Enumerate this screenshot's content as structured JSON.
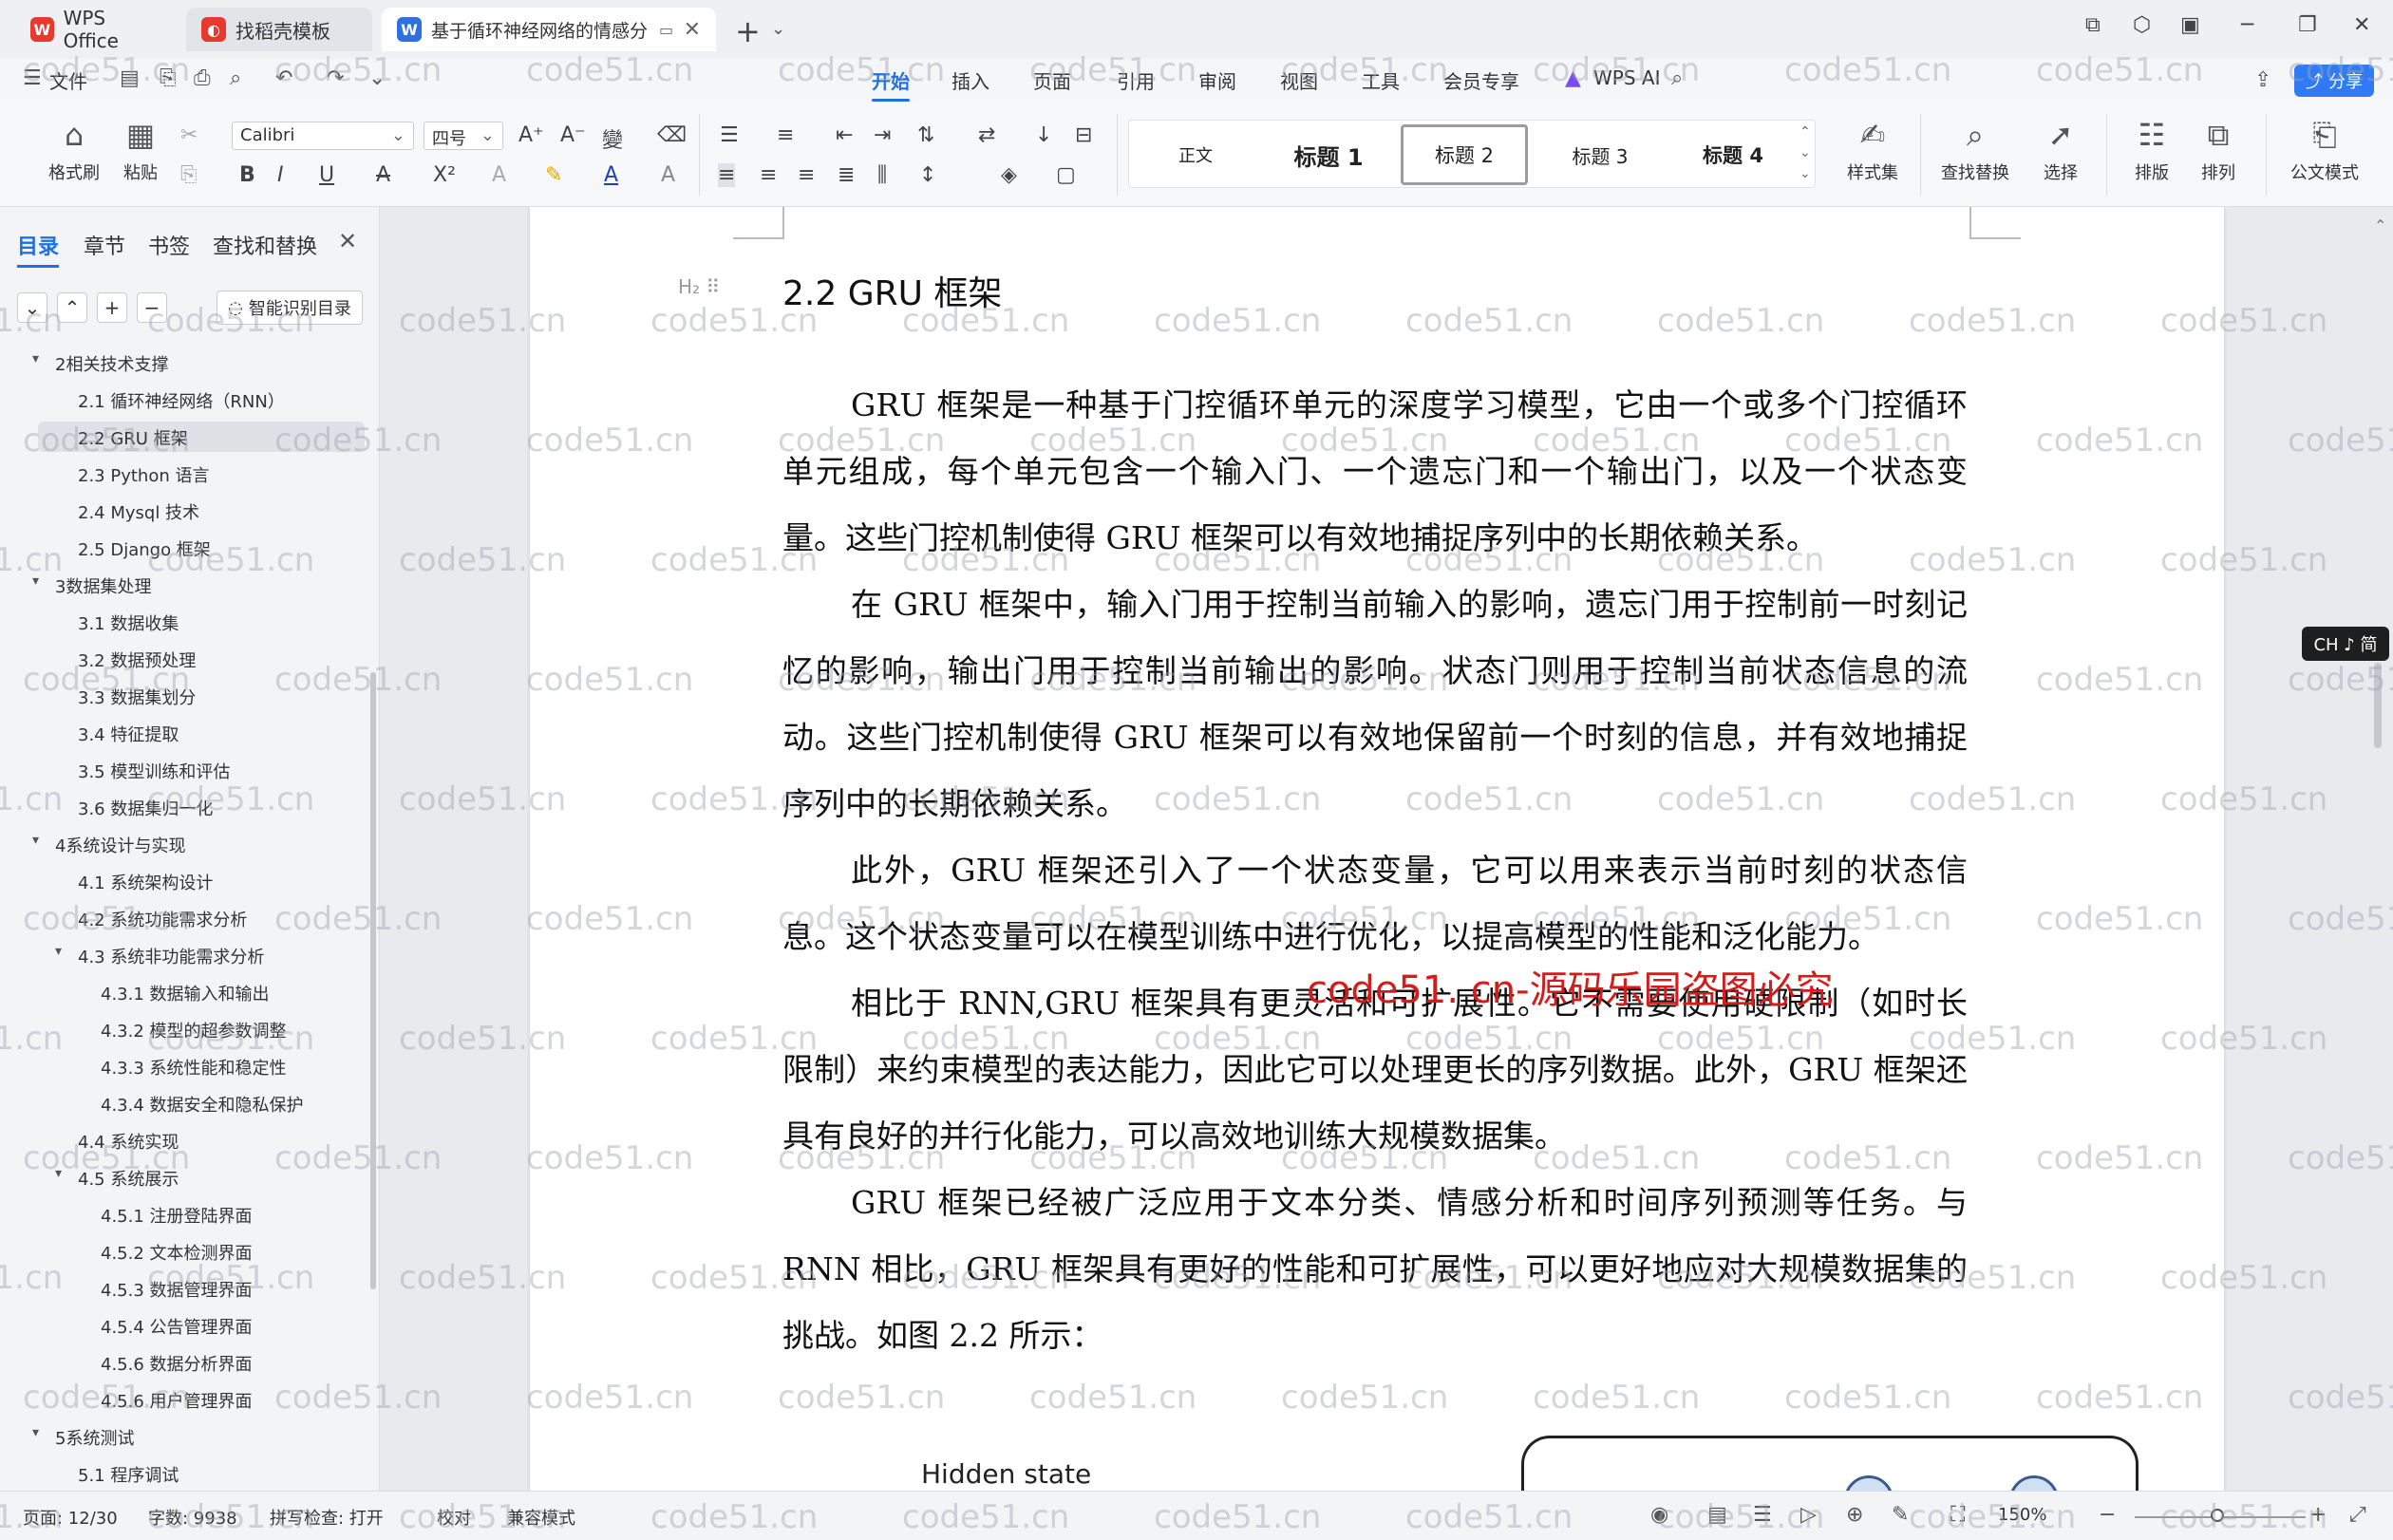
{
  "titlebar": {
    "tabs": [
      {
        "label": "WPS Office"
      },
      {
        "label": "找稻壳模板"
      },
      {
        "label": "基于循环神经网络的情感分"
      }
    ]
  },
  "menubar": {
    "file": "文件",
    "items": [
      "开始",
      "插入",
      "页面",
      "引用",
      "审阅",
      "视图",
      "工具",
      "会员专享"
    ],
    "wps_ai": "WPS AI",
    "share": "分享"
  },
  "ribbon": {
    "format_painter": "格式刷",
    "paste": "粘贴",
    "font_name": "Calibri",
    "font_size": "四号",
    "styles": [
      "正文",
      "标题 1",
      "标题 2",
      "标题 3",
      "标题 4"
    ],
    "style_set": "样式集",
    "find_replace": "查找替换",
    "select": "选择",
    "layout": "排版",
    "arrange": "排列",
    "official_mode": "公文模式"
  },
  "navpane": {
    "tabs": [
      "目录",
      "章节",
      "书签",
      "查找和替换"
    ],
    "smart_toc": "智能识别目录",
    "toc": [
      {
        "level": 1,
        "text": "2相关技术支撑",
        "expanded": true
      },
      {
        "level": 2,
        "text": "2.1 循环神经网络（RNN）"
      },
      {
        "level": 2,
        "text": "2.2 GRU 框架",
        "selected": true
      },
      {
        "level": 2,
        "text": "2.3 Python 语言"
      },
      {
        "level": 2,
        "text": "2.4 Mysql 技术"
      },
      {
        "level": 2,
        "text": "2.5 Django 框架"
      },
      {
        "level": 1,
        "text": "3数据集处理",
        "expanded": true
      },
      {
        "level": 2,
        "text": "3.1 数据收集"
      },
      {
        "level": 2,
        "text": "3.2 数据预处理"
      },
      {
        "level": 2,
        "text": "3.3 数据集划分"
      },
      {
        "level": 2,
        "text": "3.4 特征提取"
      },
      {
        "level": 2,
        "text": "3.5 模型训练和评估"
      },
      {
        "level": 2,
        "text": "3.6 数据集归一化"
      },
      {
        "level": 1,
        "text": "4系统设计与实现",
        "expanded": true
      },
      {
        "level": 2,
        "text": "4.1 系统架构设计"
      },
      {
        "level": 2,
        "text": "4.2 系统功能需求分析"
      },
      {
        "level": 2,
        "text": "4.3 系统非功能需求分析",
        "expanded": true
      },
      {
        "level": 3,
        "text": "4.3.1 数据输入和输出"
      },
      {
        "level": 3,
        "text": "4.3.2 模型的超参数调整"
      },
      {
        "level": 3,
        "text": "4.3.3 系统性能和稳定性"
      },
      {
        "level": 3,
        "text": "4.3.4 数据安全和隐私保护"
      },
      {
        "level": 2,
        "text": "4.4 系统实现"
      },
      {
        "level": 2,
        "text": "4.5 系统展示",
        "expanded": true
      },
      {
        "level": 3,
        "text": "4.5.1 注册登陆界面"
      },
      {
        "level": 3,
        "text": "4.5.2 文本检测界面"
      },
      {
        "level": 3,
        "text": "4.5.3 数据管理界面"
      },
      {
        "level": 3,
        "text": "4.5.4 公告管理界面"
      },
      {
        "level": 3,
        "text": "4.5.6 数据分析界面"
      },
      {
        "level": 3,
        "text": "4.5.6 用户管理界面"
      },
      {
        "level": 1,
        "text": "5系统测试",
        "expanded": true
      },
      {
        "level": 2,
        "text": "5.1 程序调试"
      }
    ]
  },
  "document": {
    "heading": "2.2 GRU 框架",
    "paragraphs": [
      "GRU 框架是一种基于门控循环单元的深度学习模型，它由一个或多个门控循环单元组成，每个单元包含一个输入门、一个遗忘门和一个输出门，以及一个状态变量。这些门控机制使得 GRU 框架可以有效地捕捉序列中的长期依赖关系。",
      "在 GRU 框架中，输入门用于控制当前输入的影响，遗忘门用于控制前一时刻记忆的影响，输出门用于控制当前输出的影响。状态门则用于控制当前状态信息的流动。这些门控机制使得 GRU 框架可以有效地保留前一个时刻的信息，并有效地捕捉序列中的长期依赖关系。",
      "此外，GRU 框架还引入了一个状态变量，它可以用来表示当前时刻的状态信息。这个状态变量可以在模型训练中进行优化，以提高模型的性能和泛化能力。",
      "相比于 RNN,GRU 框架具有更灵活和可扩展性。它不需要使用硬限制（如时长限制）来约束模型的表达能力，因此它可以处理更长的序列数据。此外，GRU 框架还具有良好的并行化能力，可以高效地训练大规模数据集。",
      "GRU 框架已经被广泛应用于文本分类、情感分析和时间序列预测等任务。与 RNN 相比，GRU 框架具有更好的性能和可扩展性，可以更好地应对大规模数据集的挑战。如图 2.2 所示："
    ],
    "figure_label": "Hidden state",
    "red_watermark": "code51. cn-源码乐园盗图必究",
    "watermark": "code51.cn"
  },
  "ime_badge": "CH ♪ 简",
  "statusbar": {
    "page": "页面: 12/30",
    "words": "字数: 9938",
    "spell": "拼写检查: 打开",
    "proof": "校对",
    "compat": "兼容模式",
    "zoom": "150%"
  }
}
